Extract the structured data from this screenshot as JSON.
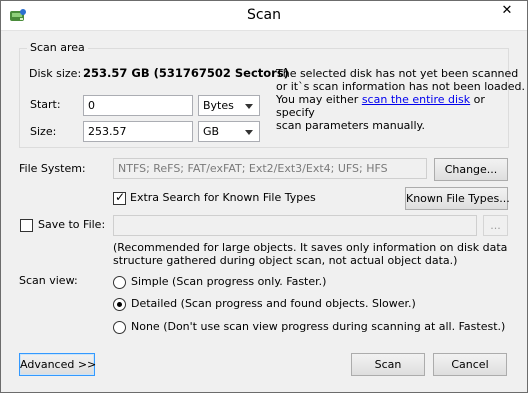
{
  "window": {
    "title": "Scan",
    "close_glyph": "✕"
  },
  "scan_area": {
    "group_label": "Scan area",
    "disk_size_label": "Disk size:",
    "disk_size_value": "253.57 GB (531767502 Sectors)",
    "message_line1": "The selected disk has not yet been scanned",
    "message_line2": "or it`s scan information has not been loaded.",
    "message_line3_pre": "You may either ",
    "message_link": "scan the entire disk",
    "message_line3_post": " or specify",
    "message_line4": "scan parameters manually.",
    "start_label": "Start:",
    "start_value": "0",
    "start_unit": "Bytes",
    "size_label": "Size:",
    "size_value": "253.57",
    "size_unit": "GB"
  },
  "file_system": {
    "label": "File System:",
    "value": "NTFS; ReFS; FAT/exFAT; Ext2/Ext3/Ext4; UFS; HFS",
    "change_button": "Change...",
    "extra_search_label": "Extra Search for Known File Types",
    "extra_search_checked": true,
    "known_file_types_button": "Known File Types..."
  },
  "save": {
    "label": "Save to File:",
    "checked": false,
    "path_value": "",
    "browse_button": "...",
    "note_line1": "(Recommended for large objects. It saves only information on disk data",
    "note_line2": "structure gathered during object scan, not actual object data.)"
  },
  "scan_view": {
    "label": "Scan view:",
    "options": [
      {
        "label": "Simple (Scan progress only. Faster.)",
        "selected": false
      },
      {
        "label": "Detailed (Scan progress and found objects. Slower.)",
        "selected": true
      },
      {
        "label": "None (Don't use scan view progress during scanning at all. Fastest.)",
        "selected": false
      }
    ]
  },
  "footer": {
    "advanced_button": "Advanced >>",
    "scan_button": "Scan",
    "cancel_button": "Cancel"
  },
  "icons": {
    "app_icon": "disk-scan-icon"
  }
}
